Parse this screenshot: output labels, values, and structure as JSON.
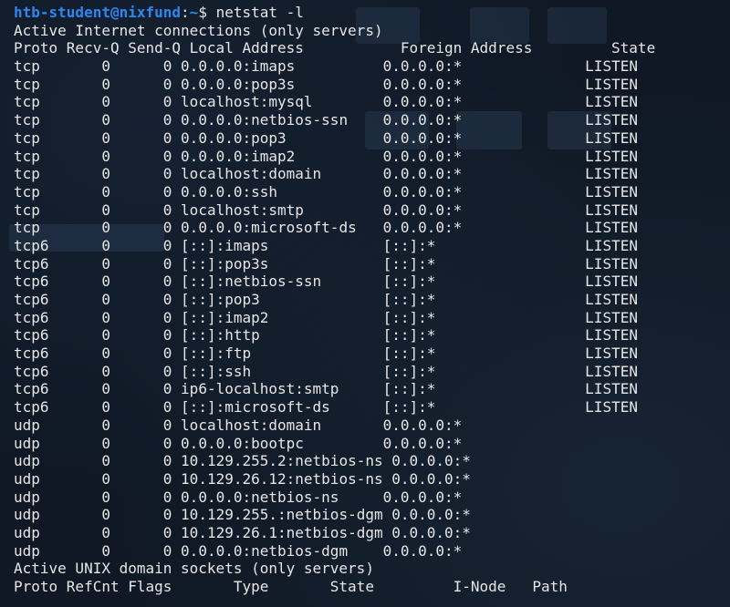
{
  "prompt": {
    "user_host": "htb-student@nixfund",
    "separator": ":",
    "path": "~",
    "symbol": "$",
    "command": "netstat -l"
  },
  "inet_header": "Active Internet connections (only servers)",
  "inet_columns": "Proto Recv-Q Send-Q Local Address           Foreign Address         State",
  "inet_rows": [
    {
      "proto": "tcp",
      "recvq": "0",
      "sendq": "0",
      "local": "0.0.0.0:imaps",
      "foreign": "0.0.0.0:*",
      "state": "LISTEN"
    },
    {
      "proto": "tcp",
      "recvq": "0",
      "sendq": "0",
      "local": "0.0.0.0:pop3s",
      "foreign": "0.0.0.0:*",
      "state": "LISTEN"
    },
    {
      "proto": "tcp",
      "recvq": "0",
      "sendq": "0",
      "local": "localhost:mysql",
      "foreign": "0.0.0.0:*",
      "state": "LISTEN"
    },
    {
      "proto": "tcp",
      "recvq": "0",
      "sendq": "0",
      "local": "0.0.0.0:netbios-ssn",
      "foreign": "0.0.0.0:*",
      "state": "LISTEN"
    },
    {
      "proto": "tcp",
      "recvq": "0",
      "sendq": "0",
      "local": "0.0.0.0:pop3",
      "foreign": "0.0.0.0:*",
      "state": "LISTEN"
    },
    {
      "proto": "tcp",
      "recvq": "0",
      "sendq": "0",
      "local": "0.0.0.0:imap2",
      "foreign": "0.0.0.0:*",
      "state": "LISTEN"
    },
    {
      "proto": "tcp",
      "recvq": "0",
      "sendq": "0",
      "local": "localhost:domain",
      "foreign": "0.0.0.0:*",
      "state": "LISTEN"
    },
    {
      "proto": "tcp",
      "recvq": "0",
      "sendq": "0",
      "local": "0.0.0.0:ssh",
      "foreign": "0.0.0.0:*",
      "state": "LISTEN"
    },
    {
      "proto": "tcp",
      "recvq": "0",
      "sendq": "0",
      "local": "localhost:smtp",
      "foreign": "0.0.0.0:*",
      "state": "LISTEN"
    },
    {
      "proto": "tcp",
      "recvq": "0",
      "sendq": "0",
      "local": "0.0.0.0:microsoft-ds",
      "foreign": "0.0.0.0:*",
      "state": "LISTEN"
    },
    {
      "proto": "tcp6",
      "recvq": "0",
      "sendq": "0",
      "local": "[::]:imaps",
      "foreign": "[::]:*",
      "state": "LISTEN"
    },
    {
      "proto": "tcp6",
      "recvq": "0",
      "sendq": "0",
      "local": "[::]:pop3s",
      "foreign": "[::]:*",
      "state": "LISTEN"
    },
    {
      "proto": "tcp6",
      "recvq": "0",
      "sendq": "0",
      "local": "[::]:netbios-ssn",
      "foreign": "[::]:*",
      "state": "LISTEN"
    },
    {
      "proto": "tcp6",
      "recvq": "0",
      "sendq": "0",
      "local": "[::]:pop3",
      "foreign": "[::]:*",
      "state": "LISTEN"
    },
    {
      "proto": "tcp6",
      "recvq": "0",
      "sendq": "0",
      "local": "[::]:imap2",
      "foreign": "[::]:*",
      "state": "LISTEN"
    },
    {
      "proto": "tcp6",
      "recvq": "0",
      "sendq": "0",
      "local": "[::]:http",
      "foreign": "[::]:*",
      "state": "LISTEN"
    },
    {
      "proto": "tcp6",
      "recvq": "0",
      "sendq": "0",
      "local": "[::]:ftp",
      "foreign": "[::]:*",
      "state": "LISTEN"
    },
    {
      "proto": "tcp6",
      "recvq": "0",
      "sendq": "0",
      "local": "[::]:ssh",
      "foreign": "[::]:*",
      "state": "LISTEN"
    },
    {
      "proto": "tcp6",
      "recvq": "0",
      "sendq": "0",
      "local": "ip6-localhost:smtp",
      "foreign": "[::]:*",
      "state": "LISTEN"
    },
    {
      "proto": "tcp6",
      "recvq": "0",
      "sendq": "0",
      "local": "[::]:microsoft-ds",
      "foreign": "[::]:*",
      "state": "LISTEN"
    },
    {
      "proto": "udp",
      "recvq": "0",
      "sendq": "0",
      "local": "localhost:domain",
      "foreign": "0.0.0.0:*",
      "state": ""
    },
    {
      "proto": "udp",
      "recvq": "0",
      "sendq": "0",
      "local": "0.0.0.0:bootpc",
      "foreign": "0.0.0.0:*",
      "state": ""
    },
    {
      "proto": "udp",
      "recvq": "0",
      "sendq": "0",
      "local": "10.129.255.2:netbios-ns",
      "foreign": "0.0.0.0:*",
      "state": ""
    },
    {
      "proto": "udp",
      "recvq": "0",
      "sendq": "0",
      "local": "10.129.26.12:netbios-ns",
      "foreign": "0.0.0.0:*",
      "state": ""
    },
    {
      "proto": "udp",
      "recvq": "0",
      "sendq": "0",
      "local": "0.0.0.0:netbios-ns",
      "foreign": "0.0.0.0:*",
      "state": ""
    },
    {
      "proto": "udp",
      "recvq": "0",
      "sendq": "0",
      "local": "10.129.255.:netbios-dgm",
      "foreign": "0.0.0.0:*",
      "state": ""
    },
    {
      "proto": "udp",
      "recvq": "0",
      "sendq": "0",
      "local": "10.129.26.1:netbios-dgm",
      "foreign": "0.0.0.0:*",
      "state": ""
    },
    {
      "proto": "udp",
      "recvq": "0",
      "sendq": "0",
      "local": "0.0.0.0:netbios-dgm",
      "foreign": "0.0.0.0:*",
      "state": ""
    }
  ],
  "unix_header": "Active UNIX domain sockets (only servers)",
  "unix_columns": "Proto RefCnt Flags       Type       State         I-Node   Path",
  "colors": {
    "prompt_user": "#2e86f1",
    "text": "#e6e6e6",
    "background": "#0f1824"
  }
}
